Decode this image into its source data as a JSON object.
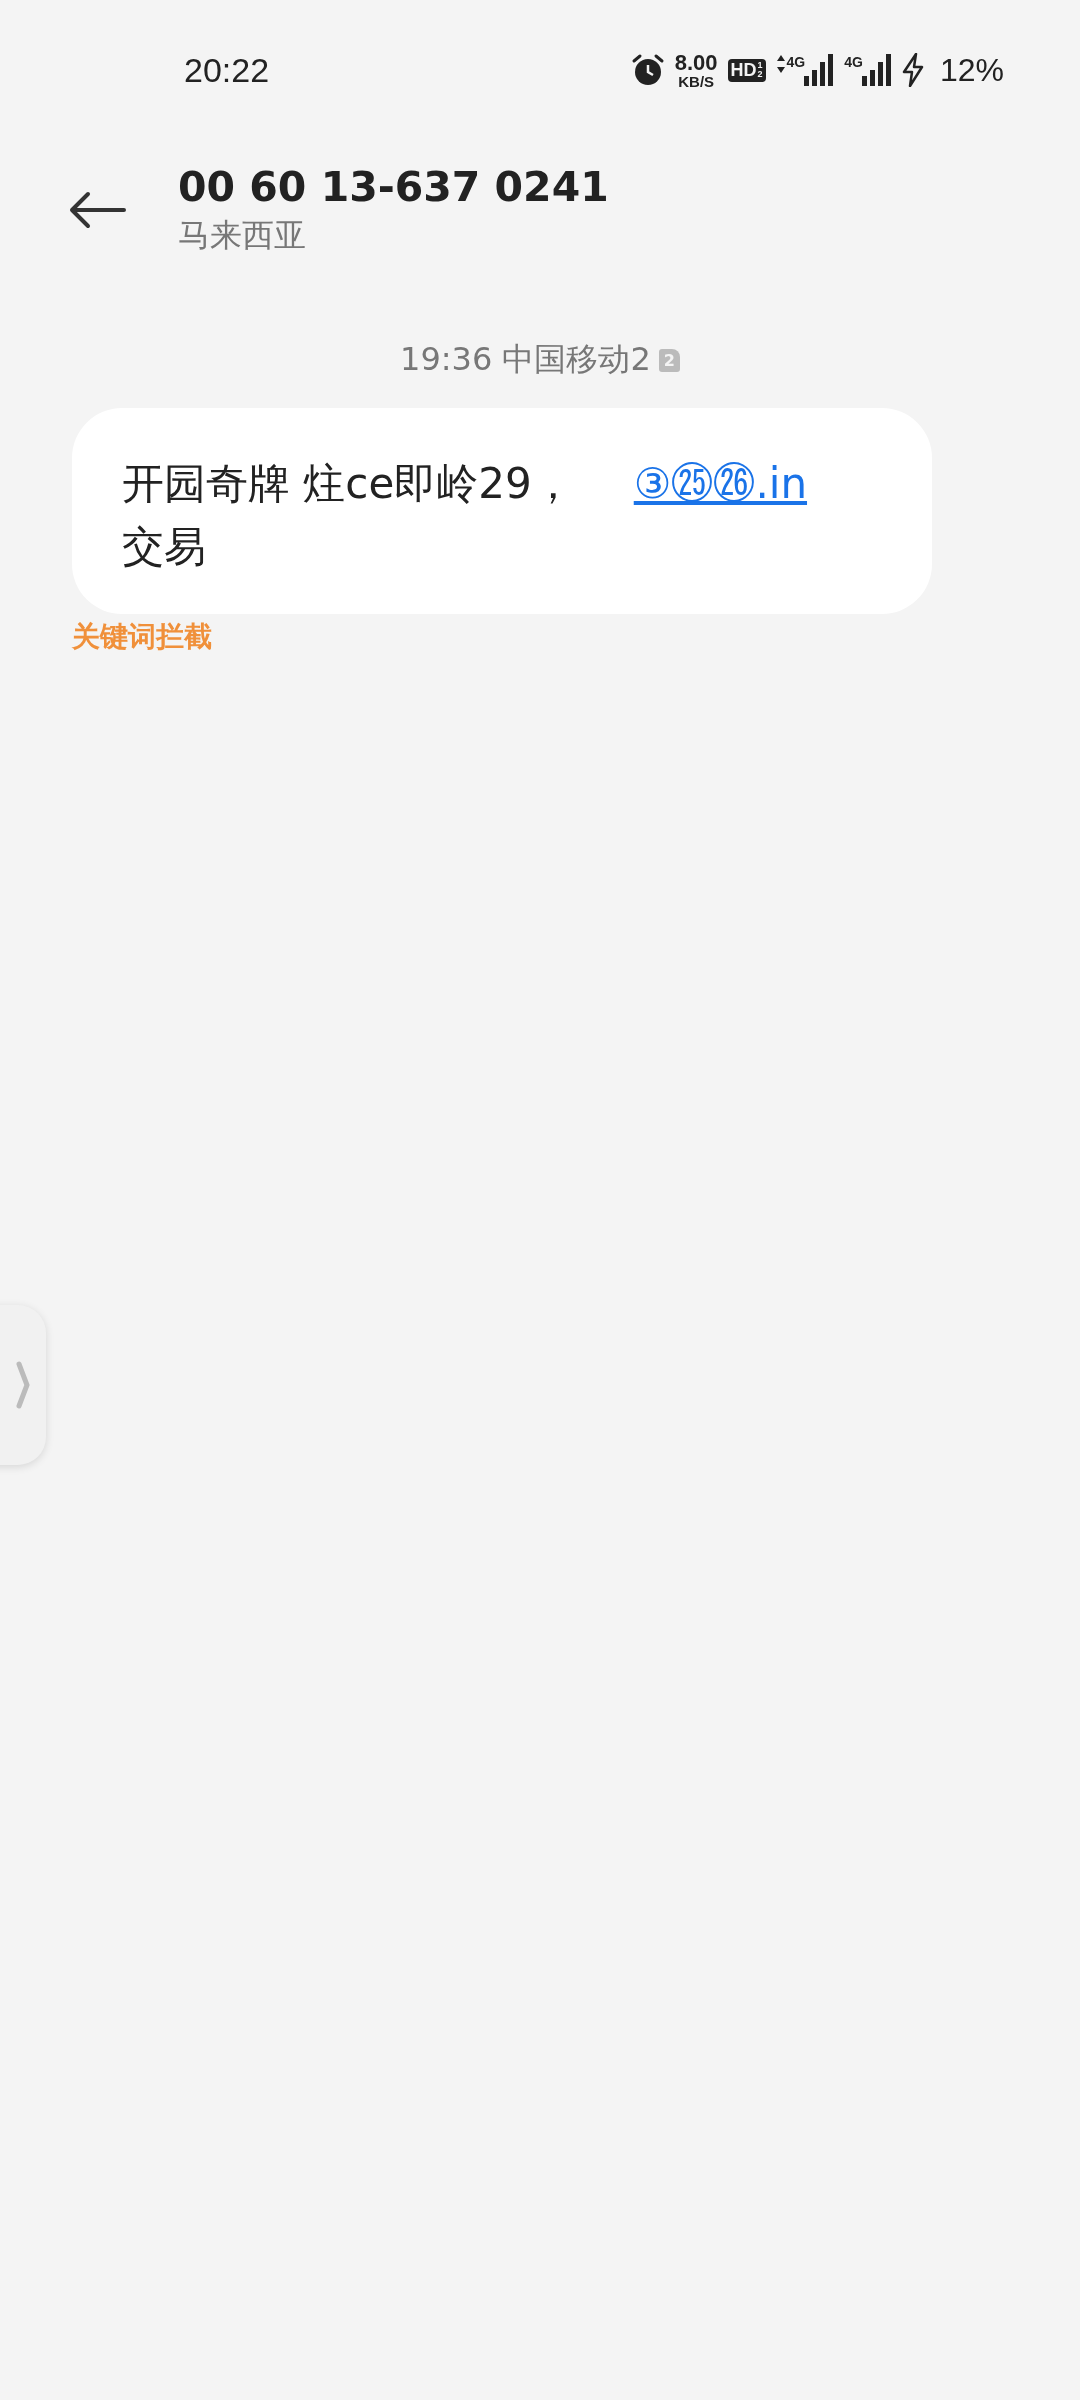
{
  "status_bar": {
    "time": "20:22",
    "speed_value": "8.00",
    "speed_unit": "KB/S",
    "hd_label": "HD",
    "hd_slots": [
      "1",
      "2"
    ],
    "networks": [
      {
        "label": "4G",
        "arrows": true
      },
      {
        "label": "4G",
        "arrows": false
      }
    ],
    "battery": "12%",
    "charging": true
  },
  "header": {
    "title": "00 60 13-637 0241",
    "subtitle": "马来西亚"
  },
  "messages": [
    {
      "timestamp": "19:36 中国移动2",
      "sim": "2",
      "text": "开园奇牌 炷ce即岭29，",
      "link": "③㉕㉖.in",
      "text_after": "交易",
      "tag": "关键词拦截"
    }
  ]
}
